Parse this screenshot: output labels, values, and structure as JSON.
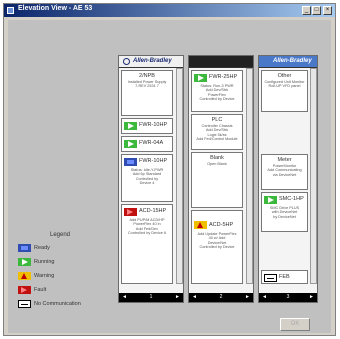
{
  "window": {
    "title": "Elevation View - AE 53",
    "min": "_",
    "max": "□",
    "close": "×"
  },
  "legend": {
    "title": "Legend",
    "items": [
      {
        "label": "Ready",
        "state": "ready"
      },
      {
        "label": "Running",
        "state": "run"
      },
      {
        "label": "Warning",
        "state": "warn"
      },
      {
        "label": "Fault",
        "state": "fault"
      },
      {
        "label": "No Communication",
        "state": "nocomm"
      }
    ]
  },
  "cabinets": [
    {
      "brand": "Allen-Bradley",
      "buckets": [
        {
          "title": "2/NPB",
          "desc": "Installed Power Supply\n7-REV 2531 7"
        },
        {
          "title": "FWR-10HP",
          "state": "run"
        },
        {
          "title": "FWR-04A",
          "state": "run"
        },
        {
          "title": "FWR-10HP",
          "state": "ready",
          "desc": "Status: Idle-Y-PWR\nAdd 6p Standard\nControlled by\nDevice 4"
        },
        {
          "title": "ACD-15HP",
          "state": "fault",
          "desc": "Add PUP/M ACD/HP\nPowerFlex 40 in\nAdd Fed/Dev\nControlled by Device 6"
        }
      ],
      "nav": {
        "left": "◄",
        "num": "1",
        "right": "►"
      }
    },
    {
      "brand": "",
      "buckets": [
        {
          "title": "FWR-25HP",
          "state": "run",
          "desc": "Status: Run-3 PWR\nAdd Dev/Strk\nPowerFlex\nControlled by Device"
        },
        {
          "title": "PLC",
          "desc": "Controller Chassis\nAdd Dev/Strk\nLogix 5k/ss\nAdd Fed/Control Module"
        },
        {
          "title": "Blank",
          "desc": "Open Blank"
        },
        {
          "title": "ACD-5HP",
          "state": "warn",
          "desc": "Add Update PowerFlex\n40 w/ Add\nDevice/Net\nControlled by Device"
        }
      ],
      "nav": {
        "left": "◄",
        "num": "2",
        "right": "►"
      }
    },
    {
      "brand": "Allen-Bradley",
      "buckets": [
        {
          "title": "Other",
          "desc": "Configured Unit Monitor\nRoll-UP VFD panel"
        },
        {
          "title": "Meter",
          "desc": "PowerMonitor\nAdd Communicating\nvia DeviceNet"
        },
        {
          "title": "SMC-1HP",
          "state": "run",
          "desc": "SMC Drive PLUS\nwith DeviceNet\nby DeviceNet"
        },
        {
          "title": "FEB",
          "state": "nocomm"
        }
      ],
      "nav": {
        "left": "◄",
        "num": "3",
        "right": "►"
      }
    }
  ],
  "ok_label": "OK",
  "colors": {
    "run": "#3cb83c",
    "ready": "#2f4cb0",
    "warn": "#f0c000",
    "fault": "#c01010",
    "brand_blue": "#4a78c8"
  }
}
